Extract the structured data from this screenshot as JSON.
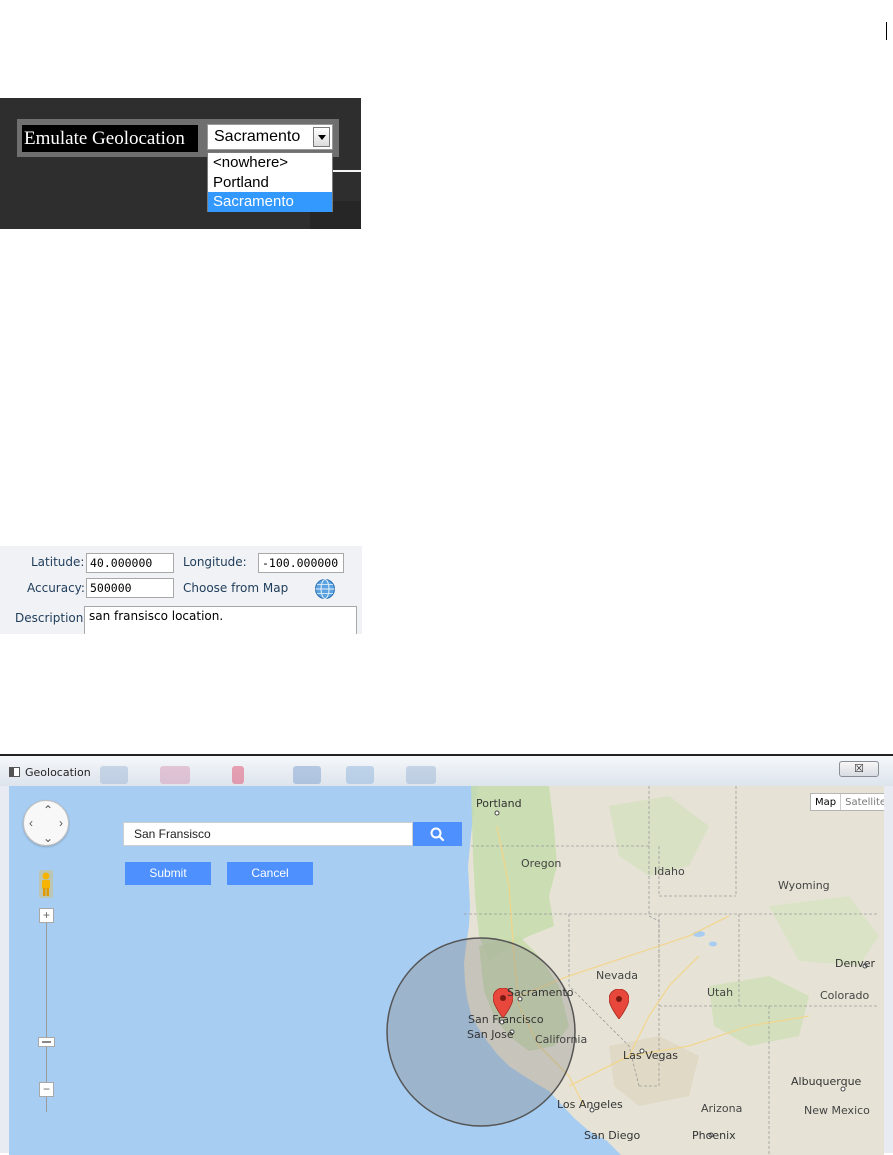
{
  "emulate_panel": {
    "label": "Emulate Geolocation",
    "selected_value": "Sacramento",
    "options": [
      "<nowhere>",
      "Portland",
      "Sacramento"
    ]
  },
  "location_form": {
    "latitude_label": "Latitude:",
    "latitude_value": "40.000000",
    "longitude_label": "Longitude:",
    "longitude_value": "-100.000000",
    "accuracy_label": "Accuracy:",
    "accuracy_value": "500000",
    "choose_map_link": "Choose from Map",
    "description_label": "Description:",
    "description_value": "san fransisco location."
  },
  "geolocation_window": {
    "title": "Geolocation",
    "close_glyph": "☒",
    "map_type": {
      "map": "Map",
      "satellite": "Satellite"
    },
    "search": {
      "value": "San Fransisco"
    },
    "submit_label": "Submit",
    "cancel_label": "Cancel",
    "zoom_in": "+",
    "zoom_out": "−",
    "map_labels": {
      "portland": "Portland",
      "oregon": "Oregon",
      "idaho": "Idaho",
      "wyoming": "Wyoming",
      "nevada": "Nevada",
      "utah": "Utah",
      "denver": "Denver",
      "colorado": "Colorado",
      "sacramento": "Sacramento",
      "san_francisco": "San Francisco",
      "san_jose": "San Jose",
      "california": "California",
      "las_vegas": "Las Vegas",
      "albuquerque": "Albuquerque",
      "new_mexico": "New Mexico",
      "los_angeles": "Los Angeles",
      "arizona": "Arizona",
      "san_diego": "San Diego",
      "phoenix": "Phoenix"
    },
    "colors": {
      "water": "#a7cdf2",
      "land": "#e6e3d6",
      "vegetation": "#c8dcae",
      "accent_blue": "#4d90fe",
      "pin_red": "#e8473b"
    }
  }
}
